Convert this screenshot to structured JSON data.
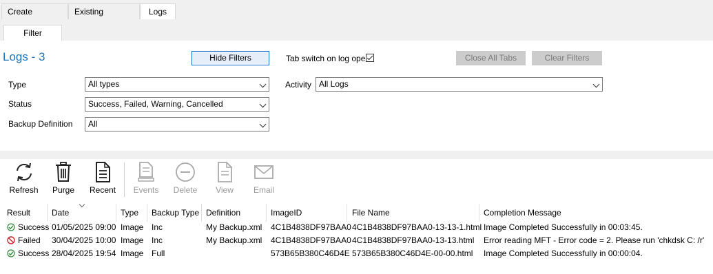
{
  "tabs": [
    "Create Backups",
    "Existing Backups",
    "Logs"
  ],
  "subtab": "Filter",
  "title": "Logs - 3",
  "buttons": {
    "hide_filters": "Hide Filters",
    "close_all_tabs": "Close All Tabs",
    "clear_filters": "Clear Filters"
  },
  "tab_switch_label": "Tab switch on log open",
  "filters": {
    "type_label": "Type",
    "type_value": "All types",
    "status_label": "Status",
    "status_value": "Success, Failed, Warning, Cancelled",
    "backup_def_label": "Backup Definition",
    "backup_def_value": "All",
    "activity_label": "Activity",
    "activity_value": "All Logs"
  },
  "toolbar": {
    "refresh": "Refresh",
    "purge": "Purge",
    "recent": "Recent",
    "events": "Events",
    "delete": "Delete",
    "view": "View",
    "email": "Email"
  },
  "columns": [
    "Result",
    "Date",
    "Type",
    "Backup Type",
    "Definition",
    "ImageID",
    "File Name",
    "Completion Message"
  ],
  "rows": [
    {
      "result": "Success",
      "date": "01/05/2025 09:00",
      "type": "Image",
      "backup_type": "Inc",
      "definition": "My Backup.xml",
      "image_id": "4C1B4838DF97BAA0",
      "file_name": "4C1B4838DF97BAA0-13-13-1.html",
      "message": "Image Completed Successfully in 00:03:45."
    },
    {
      "result": "Failed",
      "date": "30/04/2025 10:00",
      "type": "Image",
      "backup_type": "Inc",
      "definition": "My Backup.xml",
      "image_id": "4C1B4838DF97BAA0",
      "file_name": "4C1B4838DF97BAA0-13-13.html",
      "message": "Error reading MFT - Error code = 2. Please run 'chkdsk C: /r'"
    },
    {
      "result": "Success",
      "date": "28/04/2025 19:54",
      "type": "Image",
      "backup_type": "Full",
      "definition": "",
      "image_id": "573B65B380C46D4E",
      "file_name": "573B65B380C46D4E-00-00.html",
      "message": "Image Completed Successfully in 00:00:04."
    }
  ],
  "colors": {
    "title": "#1a73b8",
    "success": "#2e8b3a",
    "failed": "#d0202a"
  }
}
